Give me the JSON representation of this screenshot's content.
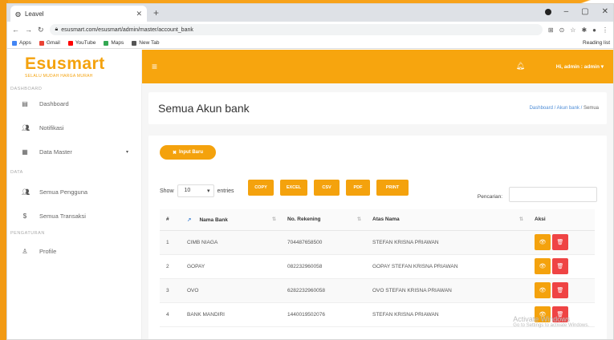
{
  "browser": {
    "tab_title": "Leavel",
    "new_tab": "+",
    "url": "esusmart.com/esusmart/admin/master/account_bank",
    "bookmarks": [
      {
        "label": "Apps",
        "color": "#4285f4"
      },
      {
        "label": "Gmail",
        "color": "#ea4335"
      },
      {
        "label": "YouTube",
        "color": "#ff0000"
      },
      {
        "label": "Maps",
        "color": "#34a853"
      },
      {
        "label": "New Tab",
        "color": "#555555"
      }
    ],
    "reading_list": "Reading list"
  },
  "brand": {
    "logo": "Esusmart",
    "tagline": "SELALU MUDAH HARGA MURAH",
    "accent": "#f4a20d"
  },
  "sidebar": {
    "section_dashboard": "DASHBOARD",
    "section_data": "DATA",
    "section_settings": "PENGATURAN",
    "items": [
      {
        "label": "Dashboard",
        "icon": "dashboard-icon"
      },
      {
        "label": "Notifikasi",
        "icon": "users-icon"
      },
      {
        "label": "Data Master",
        "icon": "grid-icon"
      },
      {
        "label": "Semua Pengguna",
        "icon": "users-icon"
      },
      {
        "label": "Semua Transaksi",
        "icon": "dollar-icon"
      },
      {
        "label": "Profile",
        "icon": "user-icon"
      }
    ]
  },
  "topbar": {
    "user": "Hi, admin : admin ▾"
  },
  "page": {
    "title": "Semua Akun bank",
    "breadcrumb": [
      "Dashboard",
      "Akun bank",
      "Semua"
    ]
  },
  "controls": {
    "import_label": "Input Baru",
    "show_label": "Show",
    "show_value": "10",
    "entries_label": "entries",
    "export_buttons": [
      "COPY",
      "EXCEL",
      "CSV",
      "PDF",
      "PRINT"
    ],
    "search_label": "Pencarian:"
  },
  "table": {
    "columns": [
      "#",
      "Nama Bank",
      "No. Rekening",
      "Atas Nama",
      "Aksi"
    ],
    "rows": [
      {
        "no": "1",
        "bank": "CIMB NIAGA",
        "rek": "704487658500",
        "nama": "STEFAN KRISNA PRIAWAN"
      },
      {
        "no": "2",
        "bank": "GOPAY",
        "rek": "082232960058",
        "nama": "GOPAY STEFAN KRISNA PRIAWAN"
      },
      {
        "no": "3",
        "bank": "OVO",
        "rek": "6282232960058",
        "nama": "OVO STEFAN KRISNA PRIAWAN"
      },
      {
        "no": "4",
        "bank": "BANK MANDIRI",
        "rek": "1440019502076",
        "nama": "STEFAN KRISNA PRIAWAN"
      }
    ]
  },
  "watermark": {
    "line1": "Activate Windows",
    "line2": "Go to Settings to activate Windows."
  }
}
